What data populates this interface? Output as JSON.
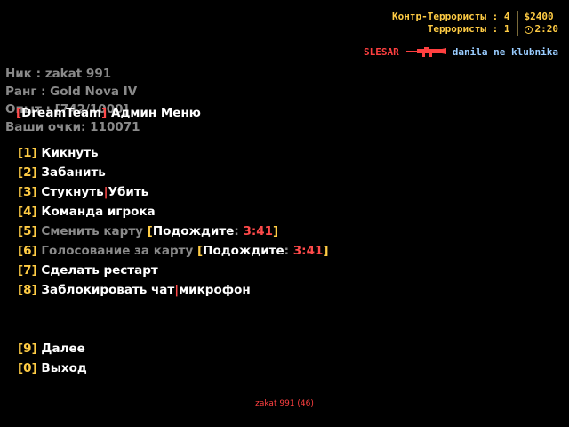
{
  "scoreboard": {
    "ct_label": "Контр-Террористы : 4",
    "t_label": "Террористы : 1",
    "money": "$2400",
    "timer": "2:20",
    "accent": "#ffcc44"
  },
  "killfeed": {
    "killer": "SLESAR",
    "weapon_icon": "rifle-icon",
    "victim": "danila ne klubnika"
  },
  "player_info": {
    "nick": "Ник : zakat 991",
    "rank": "Ранг : Gold Nova IV",
    "exp": "Опыт : [742/1000]",
    "points": "Ваши очки: 110071"
  },
  "menu": {
    "title_open": "[",
    "title_brand": "DreamTeam",
    "title_close": "]",
    "title_text": " Админ Меню",
    "items": [
      {
        "num": "[1]",
        "label": " Кикнуть"
      },
      {
        "num": "[2]",
        "label": " Забанить"
      },
      {
        "num": "[3]",
        "label_a": " Стукнуть",
        "sep": "|",
        "label_b": "Убить"
      },
      {
        "num": "[4]",
        "label": " Команда игрока"
      },
      {
        "num": "[5]",
        "label": " Сменить карту ",
        "wait_open": "[",
        "wait": "Подождите",
        "colon": ": ",
        "time": "3:41",
        "wait_close": "]"
      },
      {
        "num": "[6]",
        "label": " Голосование за карту ",
        "wait_open": "[",
        "wait": "Подождите",
        "colon": ": ",
        "time": "3:41",
        "wait_close": "]"
      },
      {
        "num": "[7]",
        "label": " Сделать рестарт"
      },
      {
        "num": "[8]",
        "label_a": " Заблокировать чат",
        "sep": "|",
        "label_b": "микрофон"
      },
      {
        "num": "[9]",
        "label": " Далее"
      },
      {
        "num": "[0]",
        "label": " Выход"
      }
    ]
  },
  "footer": {
    "text": "zakat 991 (46)"
  }
}
